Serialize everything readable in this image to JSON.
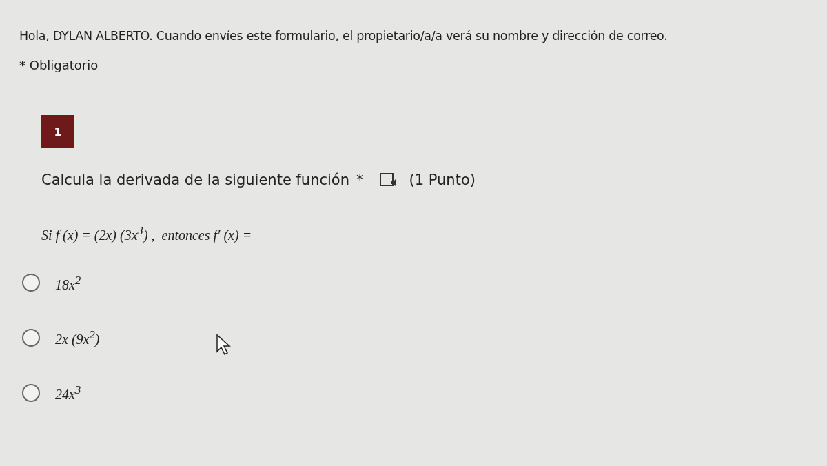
{
  "header": {
    "greeting": "Hola, DYLAN ALBERTO. Cuando envíes este formulario, el propietario/a/a verá su nombre y dirección de correo.",
    "required_note": "* Obligatorio"
  },
  "question": {
    "number": "1",
    "title": "Calcula la derivada de la siguiente función",
    "required_mark": "*",
    "points": "(1 Punto)",
    "statement": "Si f (x) = (2x) (3x$^{3}$) ,  entonces f′ (x) =",
    "options": [
      {
        "label": "18x$^{2}$",
        "selected": false
      },
      {
        "label": "2x (9x$^{2}$)",
        "selected": false
      },
      {
        "label": "24x$^{3}$",
        "selected": false
      }
    ]
  }
}
